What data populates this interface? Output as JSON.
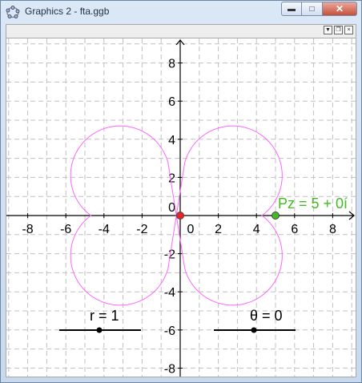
{
  "window": {
    "title": "Graphics 2 - fta.ggb",
    "minimize_icon": "minimize-icon",
    "maximize_icon": "maximize-icon",
    "close_icon": "close-icon"
  },
  "toolbar": {
    "icons": [
      "dropdown-icon",
      "restore-icon",
      "close-icon"
    ]
  },
  "graph": {
    "x_ticks": [
      "-8",
      "-6",
      "-4",
      "-2",
      "0",
      "2",
      "4",
      "6",
      "8"
    ],
    "y_ticks": [
      "8",
      "6",
      "4",
      "2",
      "0",
      "-2",
      "-4",
      "-6",
      "-8"
    ],
    "grid": true,
    "axis_color": "#000000",
    "curve_color": "#ff66ff",
    "point_label": "Pz = 5 + 0í",
    "point_color": "#44bb22",
    "origin_point_color": "#ee2222",
    "slider_r_label": "r = 1",
    "slider_theta_label": "θ = 0"
  }
}
